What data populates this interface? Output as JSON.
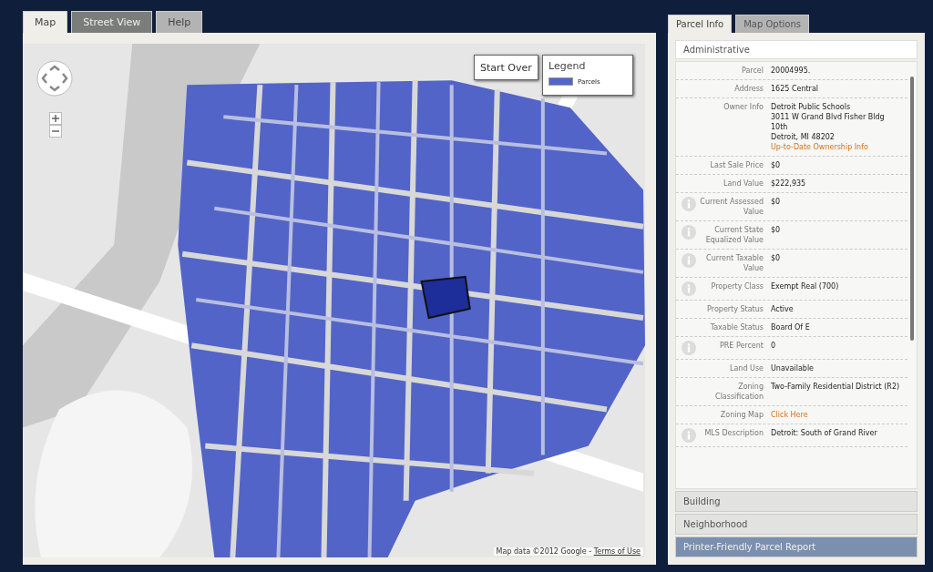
{
  "map_tabs": [
    {
      "label": "Map",
      "selected": true
    },
    {
      "label": "Street View",
      "selected": false
    },
    {
      "label": "Help",
      "selected": false
    }
  ],
  "map": {
    "start_over": "Start Over",
    "legend": {
      "title": "Legend",
      "items": [
        {
          "label": "Parcels",
          "color": "#5364c8"
        }
      ]
    },
    "attribution": "Map data ©2012 Google - ",
    "terms_link": "Terms of Use"
  },
  "panel_tabs": [
    {
      "label": "Parcel Info",
      "selected": true
    },
    {
      "label": "Map Options",
      "selected": false
    }
  ],
  "section_title": "Administrative",
  "rows": [
    {
      "label": "Parcel",
      "info": false,
      "values": [
        {
          "kind": "text",
          "text": "20004995."
        }
      ]
    },
    {
      "label": "Address",
      "info": false,
      "values": [
        {
          "kind": "text",
          "text": "1625 Central"
        }
      ]
    },
    {
      "label": "Owner Info",
      "info": false,
      "values": [
        {
          "kind": "text",
          "text": "Detroit Public Schools"
        },
        {
          "kind": "text",
          "text": "3011 W Grand Blvd Fisher Bldg"
        },
        {
          "kind": "text",
          "text": "10th"
        },
        {
          "kind": "text",
          "text": "Detroit, MI 48202"
        },
        {
          "kind": "link",
          "text": "Up-to-Date Ownership Info"
        }
      ]
    },
    {
      "label": "Last Sale Price",
      "info": false,
      "values": [
        {
          "kind": "text",
          "text": "$0"
        }
      ]
    },
    {
      "label": "Land Value",
      "info": false,
      "values": [
        {
          "kind": "text",
          "text": "$222,935"
        }
      ]
    },
    {
      "label": "Current Assessed Value",
      "info": true,
      "values": [
        {
          "kind": "text",
          "text": "$0"
        }
      ]
    },
    {
      "label": "Current State Equalized Value",
      "info": true,
      "values": [
        {
          "kind": "text",
          "text": "$0"
        }
      ]
    },
    {
      "label": "Current Taxable Value",
      "info": true,
      "values": [
        {
          "kind": "text",
          "text": "$0"
        }
      ]
    },
    {
      "label": "Property Class",
      "info": true,
      "values": [
        {
          "kind": "text",
          "text": "Exempt Real (700)"
        }
      ]
    },
    {
      "label": "Property Status",
      "info": false,
      "values": [
        {
          "kind": "text",
          "text": "Active"
        }
      ]
    },
    {
      "label": "Taxable Status",
      "info": false,
      "values": [
        {
          "kind": "text",
          "text": "Board Of E"
        }
      ]
    },
    {
      "label": "PRE Percent",
      "info": true,
      "values": [
        {
          "kind": "text",
          "text": "0"
        }
      ]
    },
    {
      "label": "Land Use",
      "info": false,
      "values": [
        {
          "kind": "text",
          "text": "Unavailable"
        }
      ]
    },
    {
      "label": "Zoning Classification",
      "info": false,
      "values": [
        {
          "kind": "text",
          "text": "Two-Family Residential District (R2)"
        }
      ]
    },
    {
      "label": "Zoning Map",
      "info": false,
      "values": [
        {
          "kind": "link",
          "text": "Click Here"
        }
      ]
    },
    {
      "label": "MLS Description",
      "info": true,
      "values": [
        {
          "kind": "text",
          "text": "Detroit: South of Grand River"
        }
      ]
    }
  ],
  "sections": [
    {
      "label": "Building",
      "kind": "collapsed"
    },
    {
      "label": "Neighborhood",
      "kind": "collapsed"
    },
    {
      "label": "Printer-Friendly Parcel Report",
      "kind": "report"
    }
  ]
}
